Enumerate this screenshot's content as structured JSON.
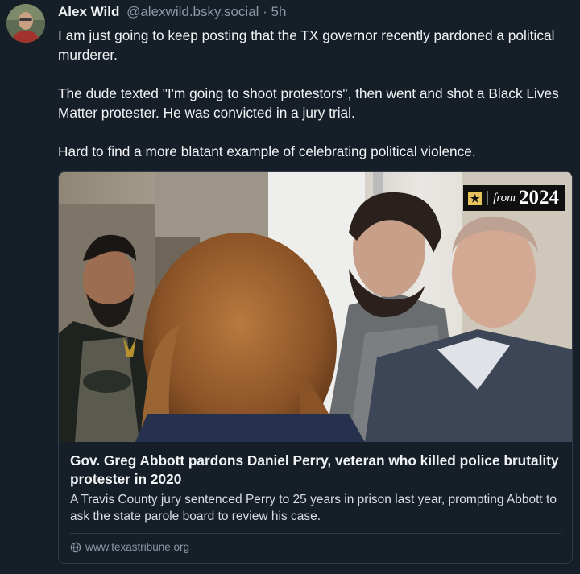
{
  "post": {
    "author_name": "Alex Wild",
    "author_handle": "@alexwild.bsky.social",
    "separator": " · ",
    "timestamp": "5h",
    "paragraphs": [
      "I am just going to keep posting that the TX governor recently pardoned a political murderer.",
      "The dude texted \"I'm going to shoot protestors\", then went and shot a Black Lives Matter protester. He was convicted in a jury trial.",
      "Hard to find a more blatant example of celebrating political violence."
    ]
  },
  "link_card": {
    "badge_from": "from",
    "badge_year": "2024",
    "title": "Gov. Greg Abbott pardons Daniel Perry, veteran who killed police brutality protester in 2020",
    "description": "A Travis County jury sentenced Perry to 25 years in prison last year, prompting Abbott to ask the state parole board to review his case.",
    "domain": "www.texastribune.org",
    "domain_icon": "globe-icon",
    "badge_icon": "star-icon"
  },
  "colors": {
    "background": "#161e27",
    "text": "#f1f3f5",
    "muted": "#8b98a5",
    "border": "#2e3a47",
    "badge_accent": "#e5c35a"
  }
}
